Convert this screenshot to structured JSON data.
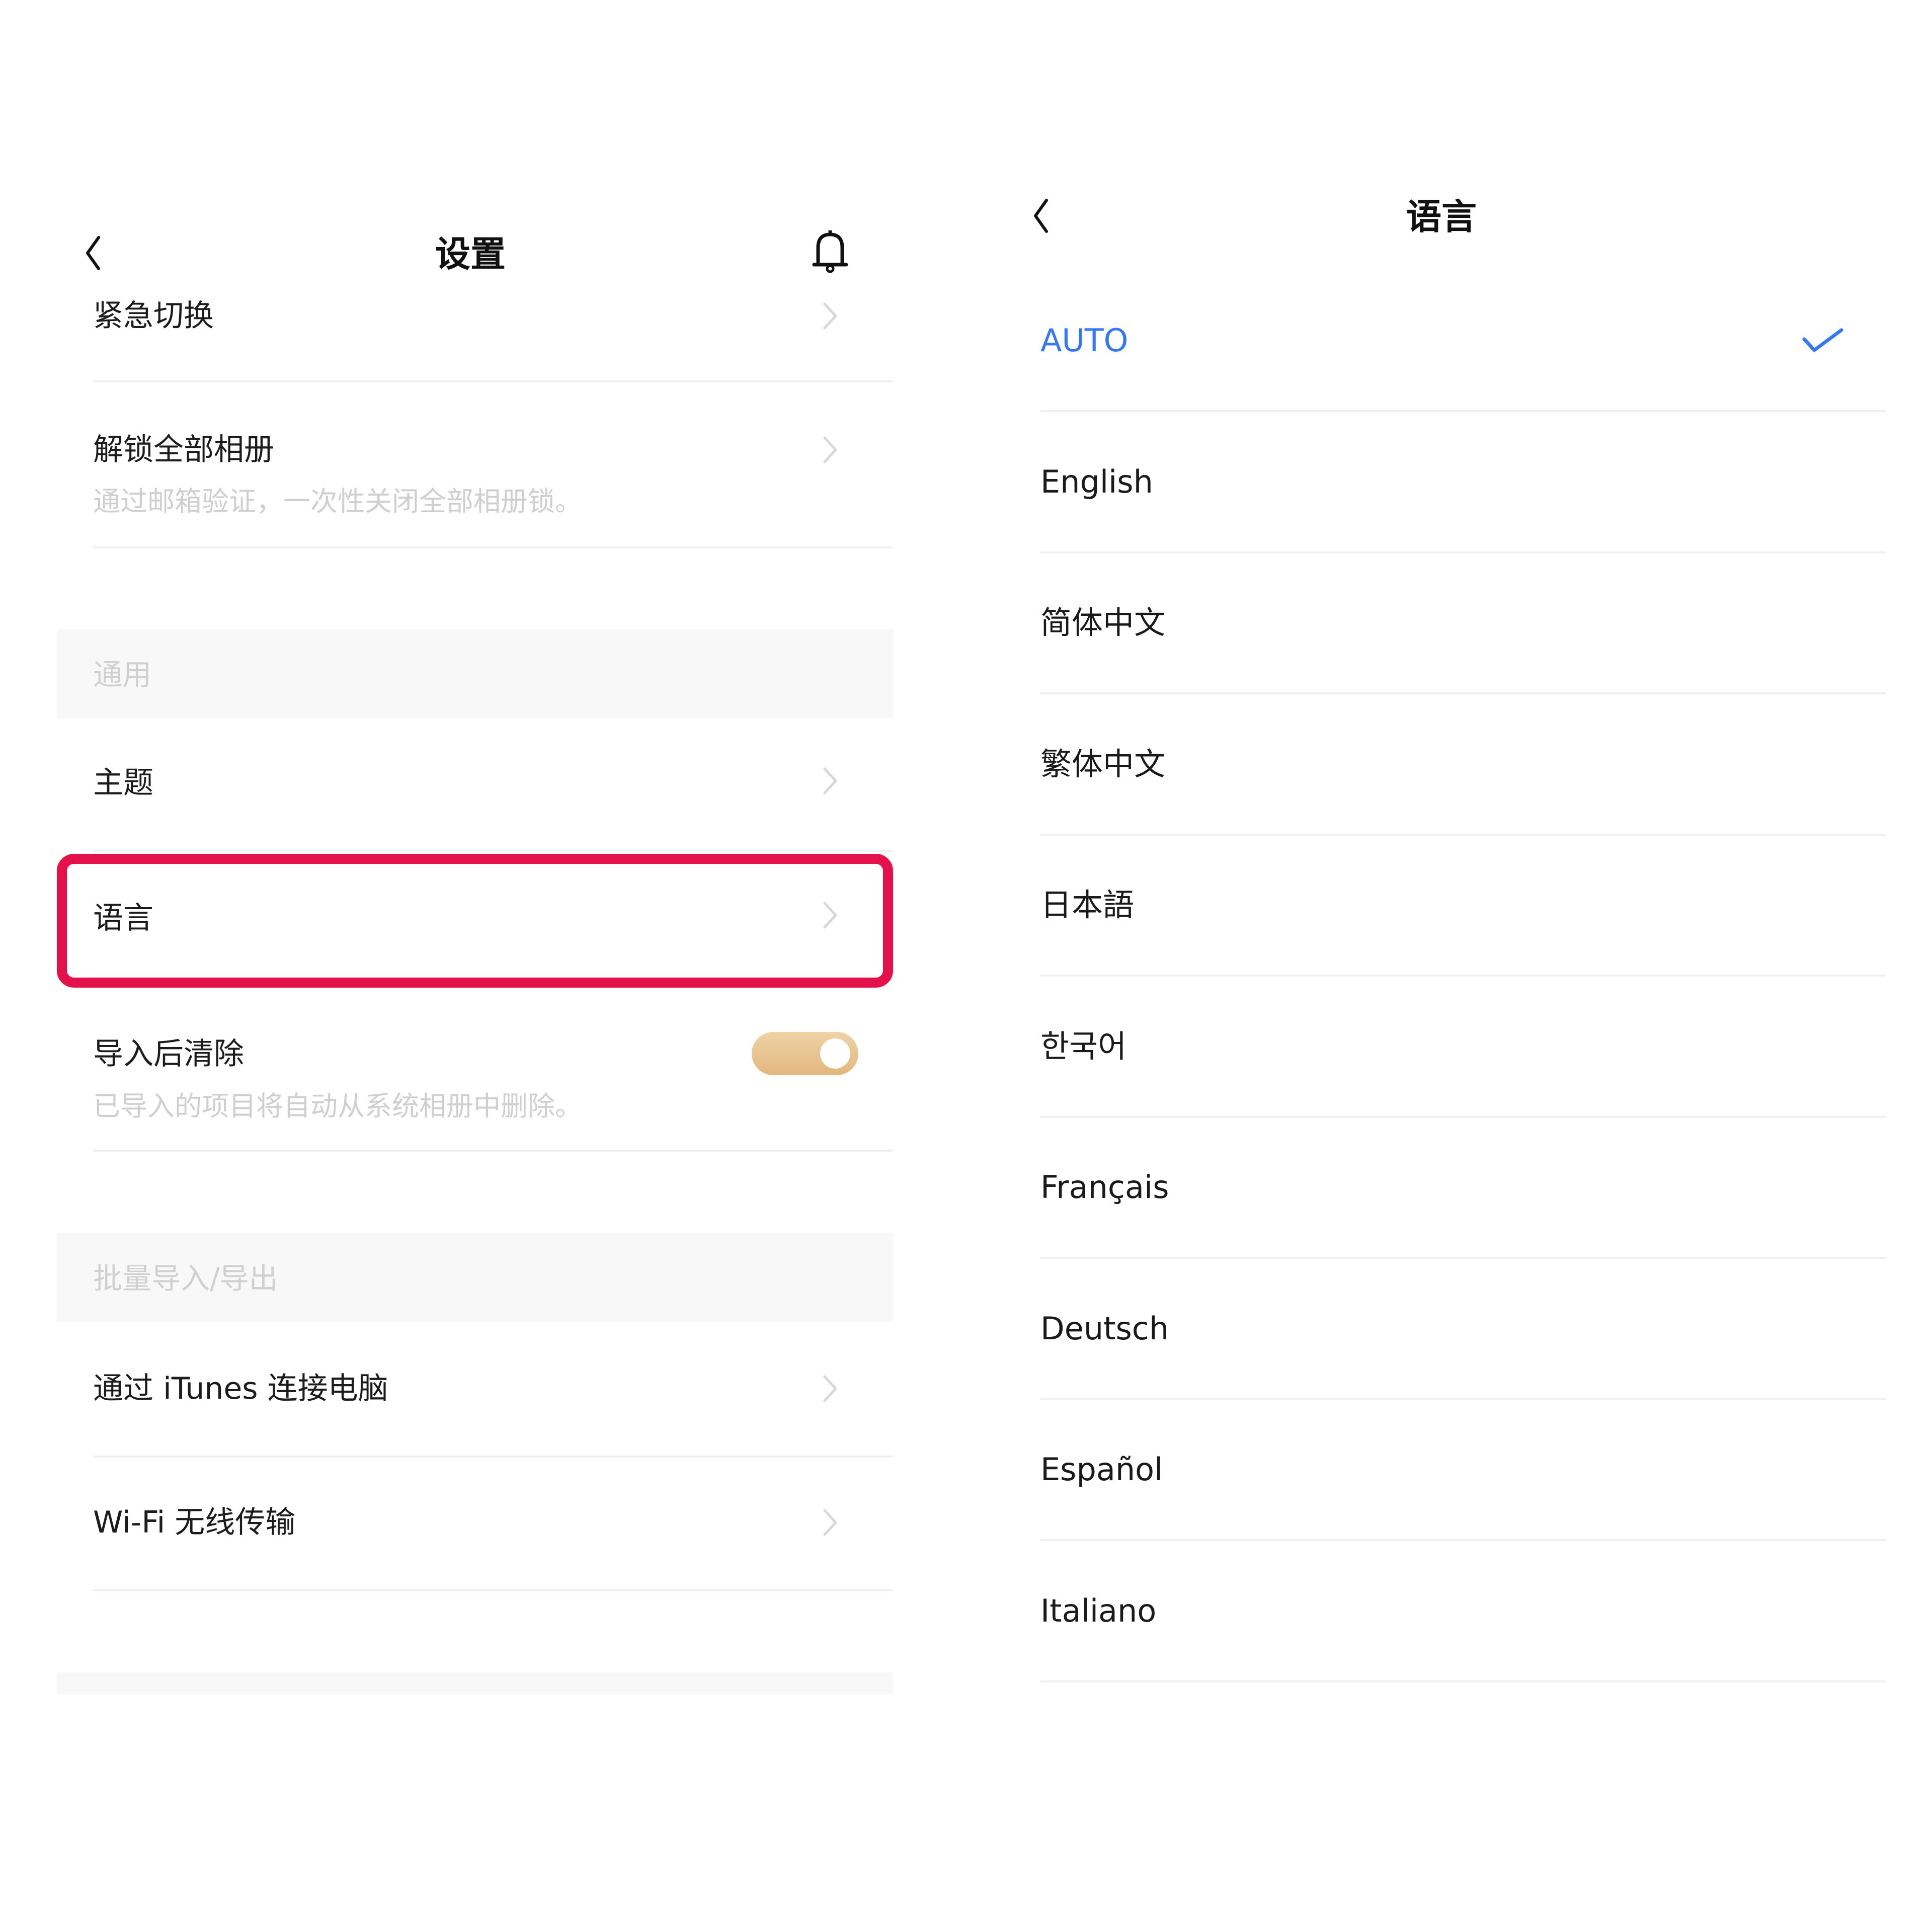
{
  "settings": {
    "header": {
      "title": "设置",
      "back_icon": "chevron-left-icon",
      "bell_icon": "bell-icon"
    },
    "rows_top": [
      {
        "label": "紧急切换",
        "icon": "chevron-right-icon"
      },
      {
        "label": "解锁全部相册",
        "subtitle": "通过邮箱验证，一次性关闭全部相册锁。",
        "icon": "chevron-right-icon"
      }
    ],
    "section_general": {
      "label": "通用",
      "items": [
        {
          "label": "主题",
          "icon": "chevron-right-icon"
        },
        {
          "label": "语言",
          "icon": "chevron-right-icon",
          "highlighted": true
        },
        {
          "label": "导入后清除",
          "subtitle": "已导入的项目将自动从系统相册中删除。",
          "toggle_on": true
        }
      ]
    },
    "section_batch": {
      "label": "批量导入/导出",
      "items": [
        {
          "label": "通过 iTunes 连接电脑",
          "icon": "chevron-right-icon"
        },
        {
          "label": "Wi-Fi 无线传输",
          "icon": "chevron-right-icon"
        }
      ]
    }
  },
  "language": {
    "header": {
      "title": "语言",
      "back_icon": "chevron-left-icon"
    },
    "selected": "AUTO",
    "options": [
      {
        "label": "AUTO",
        "selected": true
      },
      {
        "label": "English"
      },
      {
        "label": "简体中文"
      },
      {
        "label": "繁体中文"
      },
      {
        "label": "日本語"
      },
      {
        "label": "한국어"
      },
      {
        "label": "Français"
      },
      {
        "label": "Deutsch"
      },
      {
        "label": "Español"
      },
      {
        "label": "Italiano"
      }
    ]
  },
  "colors": {
    "accent_blue": "#3478f6",
    "highlight_red": "#e5114a",
    "toggle_gold": "#e3b77d"
  }
}
